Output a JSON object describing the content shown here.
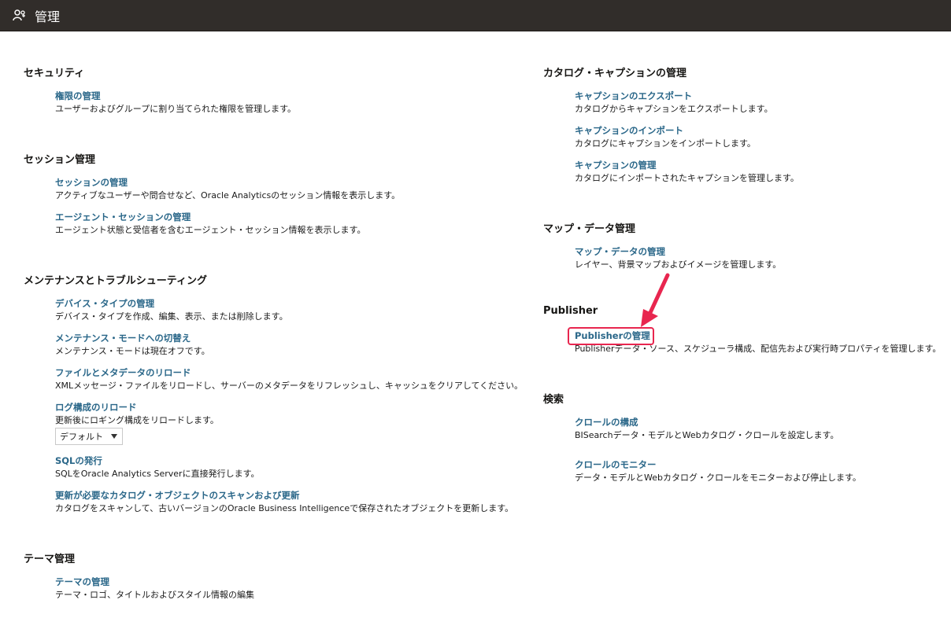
{
  "header": {
    "title": "管理",
    "icon": "users-admin-icon"
  },
  "left": {
    "security": {
      "title": "セキュリティ",
      "items": [
        {
          "label": "権限の管理",
          "desc": "ユーザーおよびグループに割り当てられた権限を管理します。"
        }
      ]
    },
    "session": {
      "title": "セッション管理",
      "items": [
        {
          "label": "セッションの管理",
          "desc": "アクティブなユーザーや問合せなど、Oracle Analyticsのセッション情報を表示します。"
        },
        {
          "label": "エージェント・セッションの管理",
          "desc": "エージェント状態と受信者を含むエージェント・セッション情報を表示します。"
        }
      ]
    },
    "maintenance": {
      "title": "メンテナンスとトラブルシューティング",
      "items": [
        {
          "label": "デバイス・タイプの管理",
          "desc": "デバイス・タイプを作成、編集、表示、または削除します。"
        },
        {
          "label": "メンテナンス・モードへの切替え",
          "desc": "メンテナンス・モードは現在オフです。"
        },
        {
          "label": "ファイルとメタデータのリロード",
          "desc": "XMLメッセージ・ファイルをリロードし、サーバーのメタデータをリフレッシュし、キャッシュをクリアしてください。"
        },
        {
          "label": "ログ構成のリロード",
          "desc": "更新後にロギング構成をリロードします。"
        },
        {
          "label": "SQLの発行",
          "desc": "SQLをOracle Analytics Serverに直接発行します。"
        },
        {
          "label": "更新が必要なカタログ・オブジェクトのスキャンおよび更新",
          "desc": "カタログをスキャンして、古いバージョンのOracle Business Intelligenceで保存されたオブジェクトを更新します。"
        }
      ],
      "log_select_value": "デフォルト"
    },
    "theme": {
      "title": "テーマ管理",
      "items": [
        {
          "label": "テーマの管理",
          "desc": "テーマ・ロゴ、タイトルおよびスタイル情報の編集"
        }
      ]
    }
  },
  "right": {
    "catalog": {
      "title": "カタログ・キャプションの管理",
      "items": [
        {
          "label": "キャプションのエクスポート",
          "desc": "カタログからキャプションをエクスポートします。"
        },
        {
          "label": "キャプションのインポート",
          "desc": "カタログにキャプションをインポートします。"
        },
        {
          "label": "キャプションの管理",
          "desc": "カタログにインポートされたキャプションを管理します。"
        }
      ]
    },
    "map": {
      "title": "マップ・データ管理",
      "items": [
        {
          "label": "マップ・データの管理",
          "desc": "レイヤー、背景マップおよびイメージを管理します。"
        }
      ]
    },
    "publisher": {
      "title": "Publisher",
      "items": [
        {
          "label": "Publisherの管理",
          "desc": "Publisherデータ・ソース、スケジューラ構成、配信先および実行時プロパティを管理します。"
        }
      ]
    },
    "search": {
      "title": "検索",
      "items": [
        {
          "label": "クロールの構成",
          "desc": "BISearchデータ・モデルとWebカタログ・クロールを設定します。"
        },
        {
          "label": "クロールのモニター",
          "desc": "データ・モデルとWebカタログ・クロールをモニターおよび停止します。"
        }
      ]
    }
  },
  "annotation": {
    "color": "#e8264f"
  }
}
